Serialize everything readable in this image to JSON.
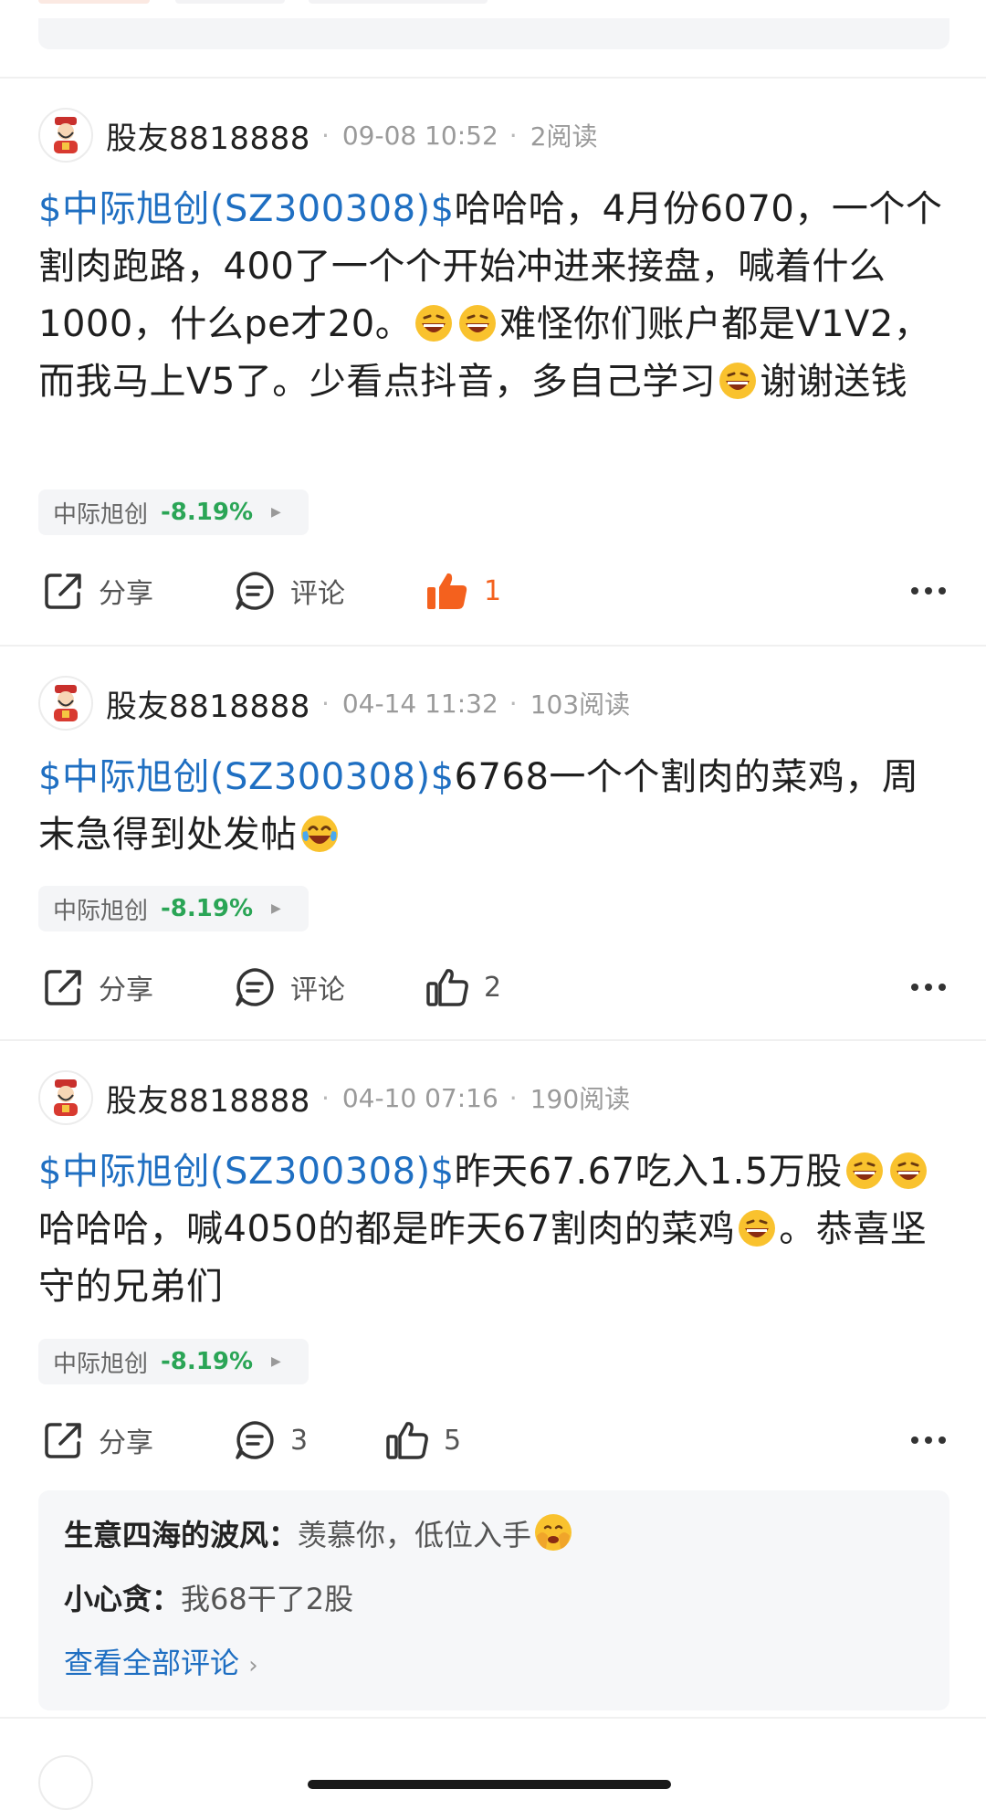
{
  "posts": [
    {
      "username": "股友8818888",
      "time": "09-08 10:52",
      "reads": "2阅读",
      "tag": "$中际旭创(SZ300308)$",
      "seg1": "哈哈哈，4月份6070，一个个割肉跑路，400了一个个开始冲进来接盘，喊着什么1000，什么pe才20。",
      "seg2": "难怪你们账户都是V1V2，而我马上V5了。少看点抖音，多自己学习",
      "seg3": "谢谢送钱",
      "stock_name": "中际旭创",
      "stock_pct": "-8.19%",
      "share_label": "分享",
      "comment_label": "评论",
      "like_count": "1"
    },
    {
      "username": "股友8818888",
      "time": "04-14 11:32",
      "reads": "103阅读",
      "tag": "$中际旭创(SZ300308)$",
      "seg1": "6768一个个割肉的菜鸡，周末急得到处发帖",
      "stock_name": "中际旭创",
      "stock_pct": "-8.19%",
      "share_label": "分享",
      "comment_label": "评论",
      "like_count": "2"
    },
    {
      "username": "股友8818888",
      "time": "04-10 07:16",
      "reads": "190阅读",
      "tag": "$中际旭创(SZ300308)$",
      "seg1": "昨天67.67吃入1.5万股",
      "seg2": "哈哈哈，喊4050的都是昨天67割肉的菜鸡",
      "seg3": "。恭喜坚守的兄弟们",
      "stock_name": "中际旭创",
      "stock_pct": "-8.19%",
      "share_label": "分享",
      "comment_count": "3",
      "like_count": "5",
      "comments": [
        {
          "author": "生意四海的波风：",
          "text": "羡慕你，低位入手"
        },
        {
          "author": "小心贪：",
          "text": "我68干了2股"
        }
      ],
      "view_all": "查看全部评论"
    }
  ],
  "colors": {
    "link_blue": "#1f6fc2",
    "down_green": "#2aa556",
    "like_orange": "#f4611e"
  }
}
